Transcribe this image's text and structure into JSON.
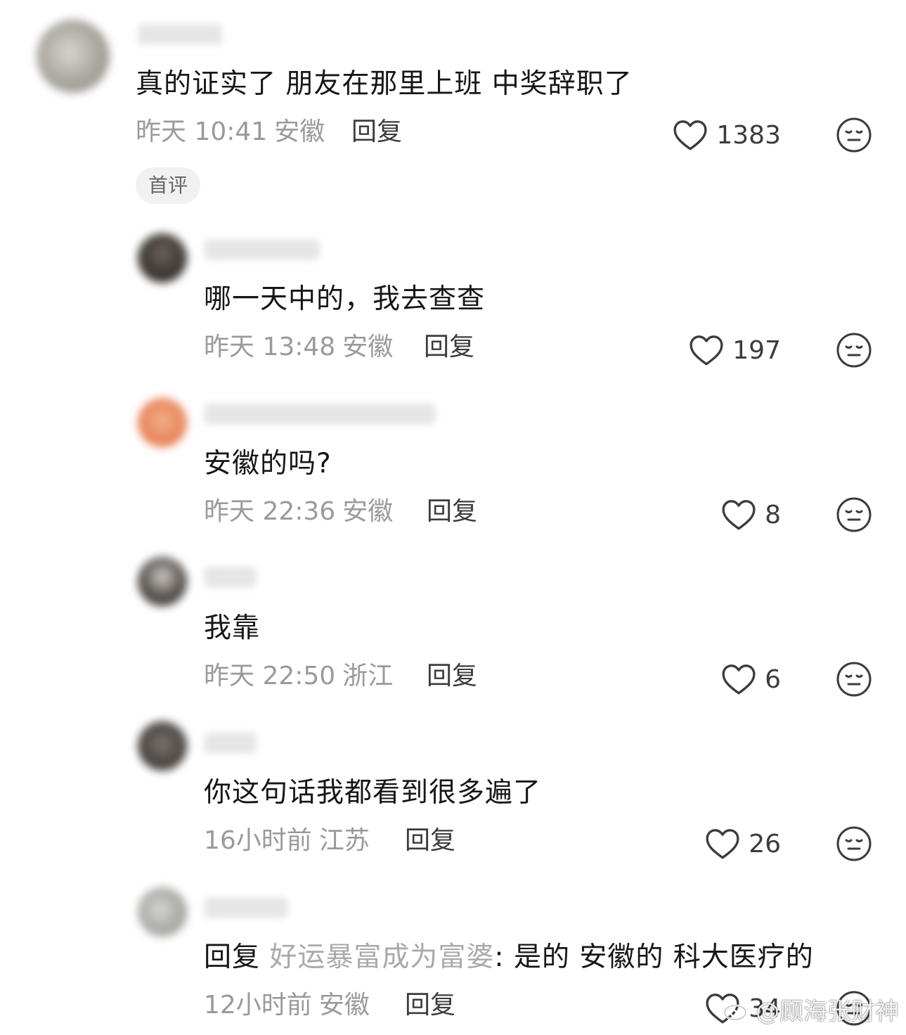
{
  "comments": [
    {
      "content": "真的证实了  朋友在那里上班  中奖辞职了",
      "time": "昨天 10:41",
      "location": "安徽",
      "reply_label": "回复",
      "likes": "1383",
      "badge": "首评",
      "avatar_color": "#a7a49c"
    },
    {
      "content": "哪一天中的，我去查查",
      "time": "昨天 13:48",
      "location": "安徽",
      "reply_label": "回复",
      "likes": "197",
      "avatar_color": "#3a3530"
    },
    {
      "content": "安徽的吗?",
      "time": "昨天 22:36",
      "location": "安徽",
      "reply_label": "回复",
      "likes": "8",
      "avatar_color": "#e8845a"
    },
    {
      "content": "我靠",
      "time": "昨天 22:50",
      "location": "浙江",
      "reply_label": "回复",
      "likes": "6",
      "avatar_color": "#55504c"
    },
    {
      "content": "你这句话我都看到很多遍了",
      "time": "16小时前",
      "location": "江苏",
      "reply_label": "回复",
      "likes": "26",
      "avatar_color": "#4a443f"
    },
    {
      "content_prefix": "回复 ",
      "mention": "好运暴富成为富婆",
      "content_suffix": ": 是的 安徽的 科大医疗的",
      "time": "12小时前",
      "location": "安徽",
      "reply_label": "回复",
      "likes": "34",
      "avatar_color": "#a9aaa5"
    }
  ],
  "watermark": "@顾海张财神",
  "icons": {
    "like": "heart-outline-icon",
    "dislike": "unhappy-face-icon",
    "watermark": "weibo-logo-icon"
  },
  "colors": {
    "text": "#161616",
    "meta": "#9a9a9a",
    "mention": "#a9a9a9",
    "icon": "#3c3c3c"
  }
}
